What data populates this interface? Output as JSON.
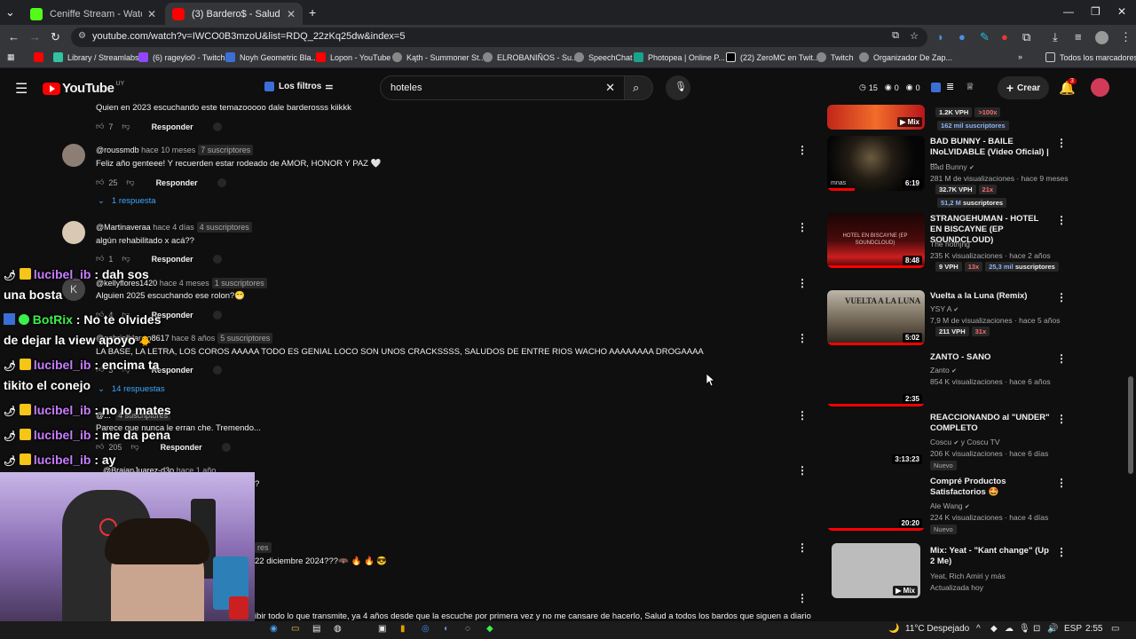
{
  "browser": {
    "tabs": [
      {
        "title": "Ceniffe Stream - Watch Live on",
        "active": false
      },
      {
        "title": "(3) Bardero$ - Salud - YouTube",
        "active": true
      }
    ],
    "url": "youtube.com/watch?v=IWCO0B3mzoU&list=RDQ_22zKq25dw&index=5",
    "bookmarks": [
      "Library / Streamlabs",
      "(6) rageylo0 - Twitch",
      "Noyh Geometric Bla...",
      "Lopon - YouTube",
      "Kąth - Summoner St...",
      "ELROBANIÑOS - Su...",
      "SpeechChat",
      "Photopea | Online P...",
      "(22) ZeroMC en Twit...",
      "Twitch",
      "Organizador De Zap..."
    ],
    "bookmarks_all": "Todos los marcadores"
  },
  "youtube": {
    "logo": "YouTube",
    "country": "UY",
    "filters": "Los filtros",
    "search_value": "hoteles",
    "stats": {
      "a": "15",
      "b": "0",
      "c": "0"
    },
    "create": "Crear",
    "notif_count": "3"
  },
  "comments": [
    {
      "text": "Quien en 2023 escuchando este temazooooo dale barderosss kiikkk",
      "likes": "7",
      "reply": "Responder"
    },
    {
      "author": "@roussmdb",
      "time": "hace 10 meses",
      "subs": "7 suscriptores",
      "text": "Feliz año genteee! Y recuerden estar rodeado de AMOR, HONOR Y PAZ 🤍",
      "likes": "25",
      "reply": "Responder",
      "replies": "1 respuesta"
    },
    {
      "author": "@Martinaveraa",
      "time": "hace 4 días",
      "subs": "4 suscriptores",
      "text": "algún rehabilitado x acá??",
      "likes": "1",
      "reply": "Responder"
    },
    {
      "author": "@kellyflores1420",
      "time": "hace 4 meses",
      "subs": "1 suscriptores",
      "text": "Alguien 2025 escuchando ese rolon?😁",
      "likes": "4",
      "reply": "Responder"
    },
    {
      "author": "@gabrielblanco8617",
      "time": "hace 8 años",
      "subs": "5 suscriptores",
      "text": "LA BASE, LA LETRA, LOS COROS AAAAA TODO ES GENIAL LOCO SON UNOS CRACKSSSS, SALUDOS DE ENTRE RIOS WACHO AAAAAAAA DROGAAAA",
      "likes": "3",
      "reply": "Responder",
      "replies": "14 respuestas"
    },
    {
      "author": "@...",
      "subs": "4 suscriptores",
      "text": "Parece que nunca le erran che. Tremendo...",
      "likes": "205",
      "reply": "Responder"
    },
    {
      "author": "@BraianJuarez-d3o",
      "time": "hace 1 año",
      "text": "?"
    },
    {
      "subs": "res",
      "text": "22 diciembre 2024???🦇 🔥 🔥 😎"
    },
    {
      "text": "ibir todo lo que transmite, ya 4 años desde que la escuche por primera vez y no me cansare de hacerlo, Salud a todos los bardos que siguen a diario"
    }
  ],
  "sidebar": [
    {
      "pills": [
        "1.2K VPH",
        ">100x"
      ],
      "subs": "162 mil suscriptores",
      "badge": "Mix"
    },
    {
      "title": "BAD BUNNY - BAILE INoLVIDABLE (Video Oficial) | ...",
      "channel": "Bad Bunny",
      "meta": "281 M de visualizaciones · hace 9 meses",
      "pills": [
        "32.7K VPH",
        "21x"
      ],
      "subs_count": "51,2 M",
      "subs_label": "suscriptores",
      "duration": "6:19",
      "thumb_text": "mnas"
    },
    {
      "title": "STRANGEHUMAN - HOTEL EN BISCAYNE (EP SOUNDCLOUD)",
      "channel": "The nothjng",
      "meta": "235 K visualizaciones · hace 2 años",
      "pills": [
        "9 VPH",
        "13x"
      ],
      "subs_count": "25,3 mil",
      "subs_label": "suscriptores",
      "duration": "8:48",
      "thumb_text": "HOTEL EN BISCAYNE (EP SOUNDCLOUD)"
    },
    {
      "title": "Vuelta a la Luna (Remix)",
      "channel": "YSY A",
      "meta": "7,9 M de visualizaciones · hace 5 años",
      "pills": [
        "211 VPH",
        "31x"
      ],
      "duration": "5:02",
      "thumb_text": "VUELTA A LA LUNA"
    },
    {
      "title": "ZANTO - SANO",
      "channel": "Zanto",
      "meta": "854 K visualizaciones · hace 6 años",
      "duration": "2:35"
    },
    {
      "title": "REACCIONANDO al \"UNDER\" COMPLETO",
      "channel": "Coscu",
      "channel_extra": "y Coscu TV",
      "meta": "206 K visualizaciones · hace 6 días",
      "badge": "Nuevo",
      "duration": "3:13:23"
    },
    {
      "title": "Compré Productos Satisfactorios 🤩",
      "channel": "Ale Wang",
      "meta": "224 K visualizaciones · hace 4 días",
      "badge": "Nuevo",
      "duration": "20:20"
    },
    {
      "title": "Mix: Yeat - \"Kant change\" (Up 2 Me)",
      "channel": "Yeat, Rich Amiri y más",
      "meta": "Actualizada hoy",
      "badge": "Mix"
    }
  ],
  "chat": [
    {
      "user": "lucibel_ib",
      "msg": ": dah sos"
    },
    {
      "msg": "una bosta"
    },
    {
      "user": "BotRix",
      "msg": ": No te olvides"
    },
    {
      "msg": "de dejar la view apoyo"
    },
    {
      "user": "lucibel_ib",
      "msg": ": encima ta"
    },
    {
      "msg": "tikito el conejo"
    },
    {
      "user": "lucibel_ib",
      "msg": ": no lo mates"
    },
    {
      "user": "lucibel_ib",
      "msg": ": me da pena"
    },
    {
      "user": "lucibel_ib",
      "msg": ": ay"
    }
  ],
  "taskbar": {
    "weather": "11°C Despejado",
    "lang": "ESP",
    "time": "2:55"
  },
  "colors": {
    "bg": "#0f0f0f",
    "red": "#ff0000",
    "link": "#3ea6ff",
    "chat_user": "#c77dff",
    "chat_bot": "#3cf04a"
  }
}
